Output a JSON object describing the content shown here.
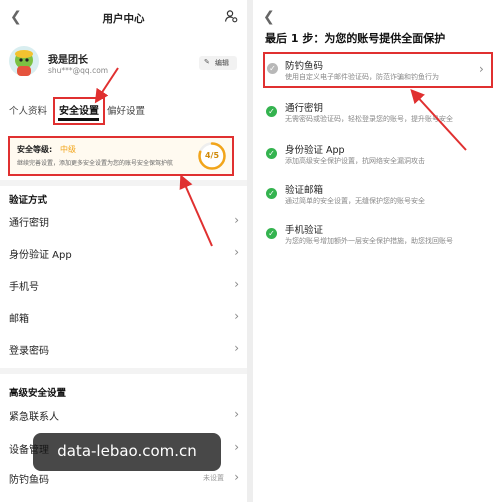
{
  "left": {
    "header_title": "用户中心",
    "user": {
      "name": "我是团长",
      "email": "shu***@qq.com",
      "edit_label": "编辑"
    },
    "tabs": [
      {
        "label": "个人资料"
      },
      {
        "label": "安全设置",
        "active": true
      },
      {
        "label": "偏好设置"
      }
    ],
    "security": {
      "level_label": "安全等级:",
      "level_value": "中级",
      "desc": "继续完善设置，添加更多安全设置为您的账号安全保驾护航",
      "score": "4/5",
      "progress": 0.8
    },
    "verify_section": "验证方式",
    "verify_items": [
      {
        "label": "通行密钥"
      },
      {
        "label": "身份验证 App"
      },
      {
        "label": "手机号"
      },
      {
        "label": "邮箱"
      },
      {
        "label": "登录密码"
      }
    ],
    "advanced_section": "高级安全设置",
    "advanced_items": [
      {
        "label": "紧急联系人"
      },
      {
        "label": "设备管理"
      },
      {
        "label": "防钓鱼码",
        "status": "未设置"
      }
    ]
  },
  "right": {
    "title": "最后 1 步：为您的账号提供全面保护",
    "items": [
      {
        "title": "防钓鱼码",
        "desc": "使用自定义电子邮件验证码，防范诈骗和钓鱼行为",
        "done": false
      },
      {
        "title": "通行密钥",
        "desc": "无需密码或验证码，轻松登录您的账号，提升账号安全",
        "done": true
      },
      {
        "title": "身份验证 App",
        "desc": "添加高级安全保护设置，抗网络安全漏洞攻击",
        "done": true
      },
      {
        "title": "验证邮箱",
        "desc": "通过简单的安全设置，无缝保护您的账号安全",
        "done": true
      },
      {
        "title": "手机验证",
        "desc": "为您的账号增加额外一层安全保护措施，助您找回账号",
        "done": true
      }
    ]
  },
  "watermark": "data-lebao.com.cn",
  "colors": {
    "accent_red": "#e03030",
    "success_green": "#34b34f",
    "level_orange": "#f2a51a"
  }
}
